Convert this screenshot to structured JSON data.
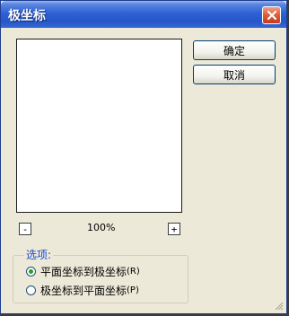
{
  "window": {
    "title": "极坐标"
  },
  "buttons": {
    "ok": "确定",
    "cancel": "取消"
  },
  "zoom": {
    "minus": "-",
    "plus": "+",
    "level": "100%"
  },
  "options": {
    "legend": "选项:",
    "rect_to_polar": {
      "label": "平面坐标到极坐标",
      "key": "(R)",
      "selected": true
    },
    "polar_to_rect": {
      "label": "极坐标到平面坐标",
      "key": "(P)",
      "selected": false
    }
  },
  "icons": {
    "close": "close-icon"
  },
  "colors": {
    "title_bar": "#2556c9",
    "close": "#c33a1e",
    "legend": "#1a49d2",
    "radio_dot": "#21a121"
  }
}
